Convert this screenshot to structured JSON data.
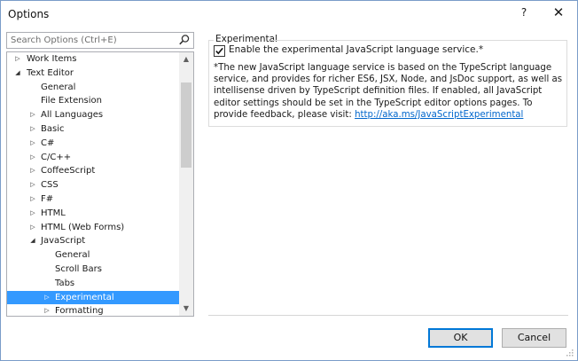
{
  "window": {
    "title": "Options",
    "help_glyph": "?",
    "close_glyph": "✕"
  },
  "search": {
    "placeholder": "Search Options (Ctrl+E)",
    "value": ""
  },
  "tree": {
    "items": [
      {
        "label": "Work Items",
        "indent": 1,
        "arrow": "▷",
        "selected": false
      },
      {
        "label": "Text Editor",
        "indent": 1,
        "arrow": "◢",
        "selected": false
      },
      {
        "label": "General",
        "indent": 2,
        "arrow": "",
        "selected": false
      },
      {
        "label": "File Extension",
        "indent": 2,
        "arrow": "",
        "selected": false
      },
      {
        "label": "All Languages",
        "indent": 2,
        "arrow": "▷",
        "selected": false
      },
      {
        "label": "Basic",
        "indent": 2,
        "arrow": "▷",
        "selected": false
      },
      {
        "label": "C#",
        "indent": 2,
        "arrow": "▷",
        "selected": false
      },
      {
        "label": "C/C++",
        "indent": 2,
        "arrow": "▷",
        "selected": false
      },
      {
        "label": "CoffeeScript",
        "indent": 2,
        "arrow": "▷",
        "selected": false
      },
      {
        "label": "CSS",
        "indent": 2,
        "arrow": "▷",
        "selected": false
      },
      {
        "label": "F#",
        "indent": 2,
        "arrow": "▷",
        "selected": false
      },
      {
        "label": "HTML",
        "indent": 2,
        "arrow": "▷",
        "selected": false
      },
      {
        "label": "HTML (Web Forms)",
        "indent": 2,
        "arrow": "▷",
        "selected": false
      },
      {
        "label": "JavaScript",
        "indent": 2,
        "arrow": "◢",
        "selected": false
      },
      {
        "label": "General",
        "indent": 3,
        "arrow": "",
        "selected": false
      },
      {
        "label": "Scroll Bars",
        "indent": 3,
        "arrow": "",
        "selected": false
      },
      {
        "label": "Tabs",
        "indent": 3,
        "arrow": "",
        "selected": false
      },
      {
        "label": "Experimental",
        "indent": 3,
        "arrow": "▷",
        "selected": true
      },
      {
        "label": "Formatting",
        "indent": 3,
        "arrow": "▷",
        "selected": false
      }
    ]
  },
  "panel": {
    "group_title": "Experimental",
    "checkbox_label": "Enable the experimental JavaScript language service.*",
    "checkbox_checked": true,
    "description": "*The new JavaScript language service is based on the TypeScript language service, and provides for richer ES6, JSX, Node, and JsDoc support, as well as intellisense driven by TypeScript definition files. If enabled, all JavaScript editor settings should be set in the TypeScript editor options pages. To provide feedback, please visit: ",
    "link": "http://aka.ms/JavaScriptExperimental"
  },
  "buttons": {
    "ok": "OK",
    "cancel": "Cancel"
  },
  "colors": {
    "selection": "#3399ff",
    "link": "#0066cc",
    "ok_border": "#0078d7"
  }
}
